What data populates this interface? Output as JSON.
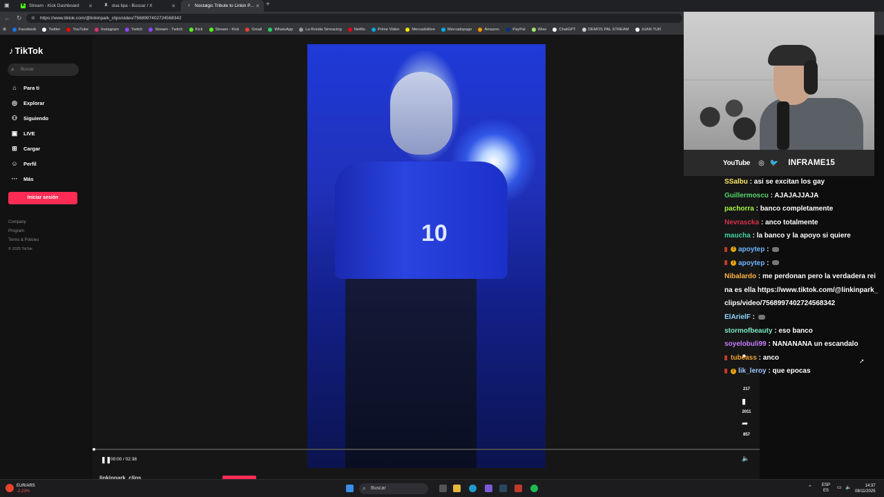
{
  "browser": {
    "tabs": [
      {
        "label": "Stream - Kick Dashboard",
        "icon": "kick-icon",
        "color": "#53fc18"
      },
      {
        "label": "dua lipa - Buscar / X",
        "icon": "x-icon",
        "color": "#ffffff"
      },
      {
        "label": "Nostalgic Tribute to Linkin P...",
        "icon": "tiktok-icon",
        "color": "#ffffff"
      }
    ],
    "new_tab": "+",
    "url": "https://www.tiktok.com/@linkinpark_clips/video/7568997402724568342",
    "bookmarks": [
      {
        "label": "Facebook",
        "color": "#1877f2"
      },
      {
        "label": "Twitter",
        "color": "#ffffff"
      },
      {
        "label": "YouTube",
        "color": "#ff0000"
      },
      {
        "label": "Instagram",
        "color": "#e1306c"
      },
      {
        "label": "Twitch",
        "color": "#9146ff"
      },
      {
        "label": "Stream - Twitch",
        "color": "#9146ff"
      },
      {
        "label": "Kick",
        "color": "#53fc18"
      },
      {
        "label": "Stream - Kick",
        "color": "#53fc18"
      },
      {
        "label": "Gmail",
        "color": "#ea4335"
      },
      {
        "label": "WhatsApp",
        "color": "#25d366"
      },
      {
        "label": "La Ronda Simracing",
        "color": "#999999"
      },
      {
        "label": "Netflix",
        "color": "#e50914"
      },
      {
        "label": "Prime Video",
        "color": "#00a8e1"
      },
      {
        "label": "Mercadolibre",
        "color": "#ffe600"
      },
      {
        "label": "Mercadopago",
        "color": "#00b1ea"
      },
      {
        "label": "Amazon.",
        "color": "#ff9900"
      },
      {
        "label": "PayPal",
        "color": "#003087"
      },
      {
        "label": "Wise",
        "color": "#9fe870"
      },
      {
        "label": "ChatGPT",
        "color": "#ffffff"
      },
      {
        "label": "DEMOS PAL STREAM",
        "color": "#cccccc"
      },
      {
        "label": "JUAN TUR",
        "color": "#ffffff"
      }
    ]
  },
  "tiktok": {
    "logo": "TikTok",
    "search_placeholder": "Buscar",
    "nav": [
      {
        "label": "Para ti",
        "icon": "home-icon",
        "glyph": "⌂"
      },
      {
        "label": "Explorar",
        "icon": "compass-icon",
        "glyph": "◎"
      },
      {
        "label": "Siguiendo",
        "icon": "following-icon",
        "glyph": "⚇"
      },
      {
        "label": "LIVE",
        "icon": "live-icon",
        "glyph": "▣"
      },
      {
        "label": "Cargar",
        "icon": "upload-icon",
        "glyph": "⊞"
      },
      {
        "label": "Perfil",
        "icon": "profile-icon",
        "glyph": "☺"
      },
      {
        "label": "Más",
        "icon": "more-icon",
        "glyph": "···"
      }
    ],
    "login": "Iniciar sesión",
    "footer": [
      "Company",
      "Program",
      "Terms & Policies",
      "© 2025 TikTok"
    ],
    "player": {
      "time": "00:00 / 02:38",
      "jersey_number": "10",
      "author": "linkinpark_clips",
      "progress": 0.0
    },
    "actions": [
      {
        "icon": "comment-icon",
        "count": "217"
      },
      {
        "icon": "bookmark-icon",
        "count": "2011"
      },
      {
        "icon": "share-icon",
        "count": "857"
      }
    ]
  },
  "stream": {
    "platform_label": "YouTube",
    "channel": "INFRAME15"
  },
  "chat": [
    {
      "user": "SSalbu",
      "color": "#f5e663",
      "text": "asi se excitan los gay",
      "badges": []
    },
    {
      "user": "Guillermoscu",
      "color": "#53d66b",
      "text": "AJAJAJJAJA",
      "badges": []
    },
    {
      "user": "pachorra",
      "color": "#a8f542",
      "text": "banco completamente",
      "badges": []
    },
    {
      "user": "Nevrascka",
      "color": "#d9304a",
      "text": "anco totalmente",
      "badges": []
    },
    {
      "user": "maucha",
      "color": "#3ed6a0",
      "text": "la banco y la apoyo si quiere",
      "badges": []
    },
    {
      "user": "apoytep",
      "color": "#6fb4ff",
      "text": "",
      "badges": [
        "sub",
        "gift"
      ],
      "emote": true
    },
    {
      "user": "apoytep",
      "color": "#6fb4ff",
      "text": "",
      "badges": [
        "sub",
        "gift"
      ],
      "emote": true
    },
    {
      "user": "Nibalardo",
      "color": "#ffb347",
      "text": "me perdonan pero la verdadera reina es ella https://www.tiktok.com/@linkinpark_clips/video/7568997402724568342",
      "badges": []
    },
    {
      "user": "ElArielF",
      "color": "#8fd8ff",
      "text": "",
      "badges": [],
      "emote": true
    },
    {
      "user": "stormofbeauty",
      "color": "#7ee8c8",
      "text": "eso banco",
      "badges": []
    },
    {
      "user": "soyelobuli99",
      "color": "#c77dff",
      "text": "NANANANA un escandalo",
      "badges": []
    },
    {
      "user": "tubeass",
      "color": "#f0a030",
      "text": "anco",
      "badges": [
        "sub"
      ]
    },
    {
      "user": "lik_leroy",
      "color": "#a0c8ff",
      "text": "que epocas",
      "badges": [
        "sub",
        "gift"
      ]
    }
  ],
  "taskbar": {
    "weather_label": "EUR/ARS",
    "weather_value": "-2,23%",
    "search": "Buscar",
    "lang1": "ESP",
    "lang2": "ES",
    "time": "14:37",
    "date": "08/11/2025"
  }
}
